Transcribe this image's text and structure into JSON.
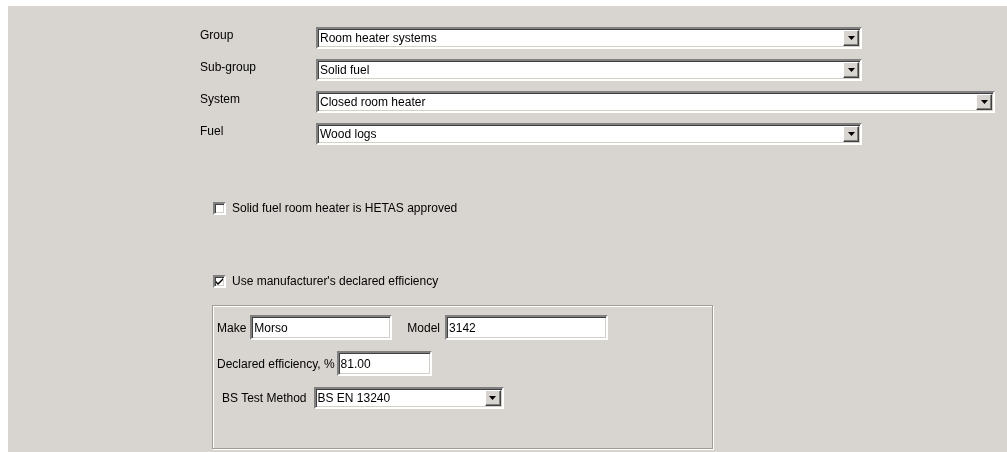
{
  "fields": [
    {
      "label": "Group",
      "value": "Room heater systems"
    },
    {
      "label": "Sub-group",
      "value": "Solid fuel"
    },
    {
      "label": "System",
      "value": "Closed room heater"
    },
    {
      "label": "Fuel",
      "value": "Wood logs"
    }
  ],
  "hetas_approved": {
    "label": "Solid fuel room heater is HETAS approved",
    "checked": false
  },
  "use_declared_efficiency": {
    "label": "Use manufacturer's declared efficiency",
    "checked": true
  },
  "declared_details": {
    "make": {
      "label": "Make",
      "value": "Morso"
    },
    "model": {
      "label": "Model",
      "value": "3142"
    },
    "efficiency": {
      "label": "Declared efficiency, %",
      "value": "81.00"
    },
    "test_method": {
      "label": "BS Test Method",
      "value": "BS EN 13240"
    }
  }
}
